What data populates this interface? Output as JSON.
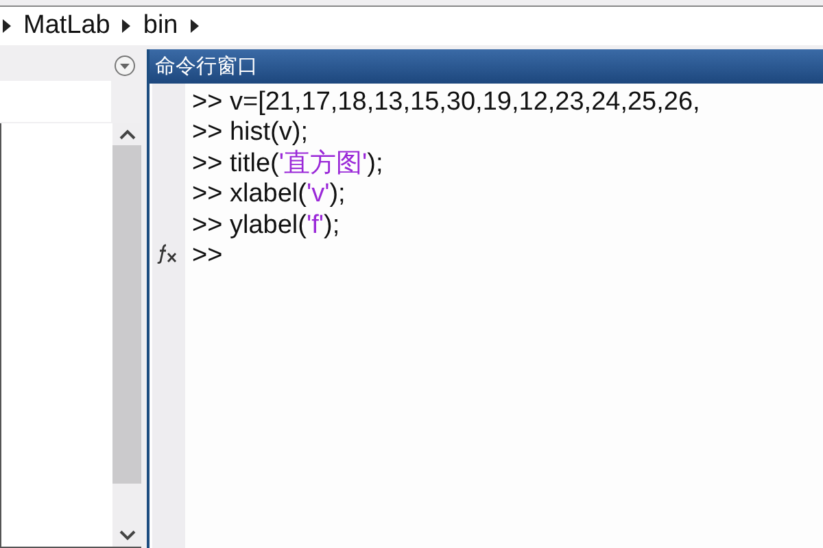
{
  "breadcrumb": {
    "items": [
      "MatLab",
      "bin"
    ]
  },
  "command_window": {
    "title": "命令行窗口",
    "prompt": ">>",
    "lines": [
      {
        "parts": [
          {
            "kind": "code",
            "text": "v=[21,17,18,13,15,30,19,12,23,24,25,26,"
          }
        ]
      },
      {
        "parts": [
          {
            "kind": "code",
            "text": "hist(v);"
          }
        ]
      },
      {
        "parts": [
          {
            "kind": "code",
            "text": "title("
          },
          {
            "kind": "string",
            "text": "'直方图'"
          },
          {
            "kind": "code",
            "text": ");"
          }
        ]
      },
      {
        "parts": [
          {
            "kind": "code",
            "text": "xlabel("
          },
          {
            "kind": "string",
            "text": "'v'"
          },
          {
            "kind": "code",
            "text": ");"
          }
        ]
      },
      {
        "parts": [
          {
            "kind": "code",
            "text": "ylabel("
          },
          {
            "kind": "string",
            "text": "'f'"
          },
          {
            "kind": "code",
            "text": ");"
          }
        ]
      }
    ]
  }
}
